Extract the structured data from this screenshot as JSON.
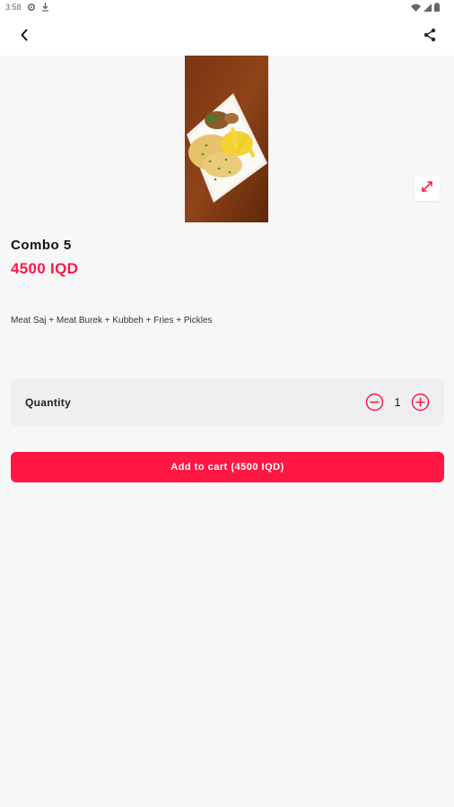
{
  "status_bar": {
    "time": "3:58",
    "icons": [
      "settings-icon",
      "download-icon",
      "wifi-icon",
      "signal-icon",
      "battery-icon"
    ]
  },
  "top_bar": {
    "back_icon": "chevron-left-icon",
    "share_icon": "share-icon"
  },
  "product": {
    "image_icon": "food-photo",
    "expand_icon": "expand-icon",
    "name": "Combo 5",
    "price": "4500 IQD",
    "description": "Meat Saj + Meat Burek + Kubbeh + Fries + Pickles"
  },
  "quantity": {
    "label": "Quantity",
    "value": "1",
    "minus_icon": "minus-circle-icon",
    "plus_icon": "plus-circle-icon"
  },
  "cart": {
    "button_label": "Add to cart (4500 IQD)"
  },
  "colors": {
    "accent": "#ff1744",
    "background": "#f7f7f8",
    "surface": "#ffffff",
    "quantity_bg": "#efeff2"
  }
}
